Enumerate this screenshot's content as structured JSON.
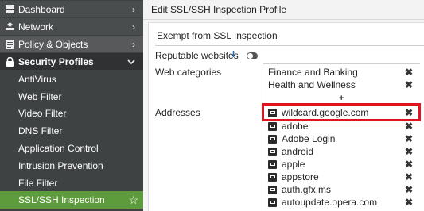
{
  "sidebar": {
    "items": [
      {
        "label": "Dashboard",
        "icon": "dashboard-icon",
        "chevron": "›"
      },
      {
        "label": "Network",
        "icon": "network-icon",
        "chevron": "›"
      },
      {
        "label": "Policy & Objects",
        "icon": "policy-icon",
        "chevron": "›"
      },
      {
        "label": "Security Profiles",
        "icon": "lock-icon",
        "chevron": "⌄"
      },
      {
        "label": "AntiVirus"
      },
      {
        "label": "Web Filter"
      },
      {
        "label": "Video Filter"
      },
      {
        "label": "DNS Filter"
      },
      {
        "label": "Application Control"
      },
      {
        "label": "Intrusion Prevention"
      },
      {
        "label": "File Filter"
      },
      {
        "label": "SSL/SSH Inspection",
        "star": "☆"
      }
    ]
  },
  "header": {
    "title": "Edit SSL/SSH Inspection Profile"
  },
  "section": {
    "title": "Exempt from SSL Inspection",
    "reputable_label": "Reputable websites",
    "info_glyph": "i",
    "web_categories_label": "Web categories",
    "addresses_label": "Addresses"
  },
  "web_categories": [
    "Finance and Banking",
    "Health and Wellness"
  ],
  "add_glyph": "+",
  "remove_glyph": "✖",
  "addresses": [
    "wildcard.google.com",
    "adobe",
    "Adobe Login",
    "android",
    "apple",
    "appstore",
    "auth.gfx.ms",
    "autoupdate.opera.com"
  ],
  "colors": {
    "accent": "#5e9b3c",
    "highlight": "#e0141e",
    "sidebar": "#3f4243"
  }
}
